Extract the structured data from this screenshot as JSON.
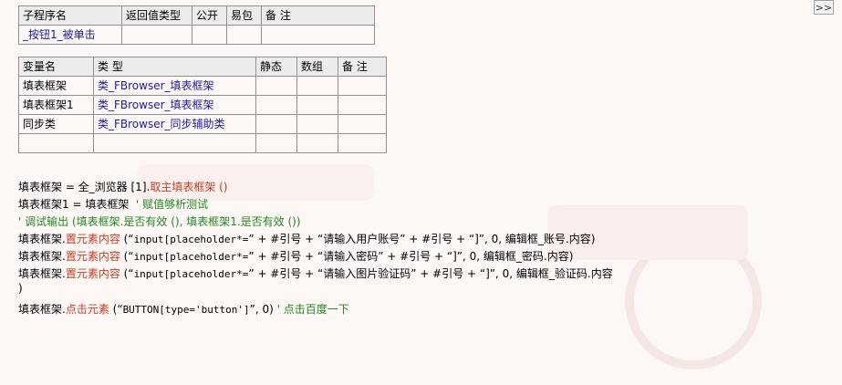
{
  "scroll_label": ">>",
  "sub_table": {
    "headers": [
      "子程序名",
      "返回值类型",
      "公开",
      "易包",
      "备 注"
    ],
    "row": [
      "_按钮1_被单击",
      "",
      "",
      "",
      ""
    ]
  },
  "var_table": {
    "headers": [
      "变量名",
      "类 型",
      "静态",
      "数组",
      "备 注"
    ],
    "rows": [
      [
        "填表框架",
        "类_FBrowser_填表框架",
        "",
        "",
        ""
      ],
      [
        "填表框架1",
        "类_FBrowser_填表框架",
        "",
        "",
        ""
      ],
      [
        "同步类",
        "类_FBrowser_同步辅助类",
        "",
        "",
        ""
      ],
      [
        "",
        "",
        "",
        "",
        ""
      ]
    ]
  },
  "code": {
    "l1_a": "填表框架 = 全_浏览器 [1].",
    "l1_b": "取主填表框架 ()",
    "l2_a": "填表框架1 = 填表框架",
    "l2_b": "' 赋值够析测试",
    "l3": "' 调试输出 (填表框架.是否有效 (), 填表框架1.是否有效 ())",
    "l4_a": "填表框架.",
    "l4_b": "置元素内容",
    "l4_c": " (“",
    "l4_d": "input[placeholder*=",
    "l4_e": "” + #引号 + “请输入用户账号” + #引号 + “]”, 0, 编辑框_账号.内容)",
    "l5_a": "填表框架.",
    "l5_b": "置元素内容",
    "l5_c": " (“",
    "l5_d": "input[placeholder*=",
    "l5_e": "” + #引号 + “请输入密码” + #引号 + “]”, 0, 编辑框_密码.内容)",
    "l6_a": "填表框架.",
    "l6_b": "置元素内容",
    "l6_c": " (“",
    "l6_d": "input[placeholder*=",
    "l6_e": "” + #引号 + “请输入图片验证码” + #引号 + “]”, 0, 编辑框_验证码.内容",
    "l7": ")",
    "l8_a": "填表框架.",
    "l8_b": "点击元素",
    "l8_c": " (“",
    "l8_d": "BUTTON[type='button']",
    "l8_e": "”, 0)",
    "l8_f": " ' 点击百度一下"
  }
}
